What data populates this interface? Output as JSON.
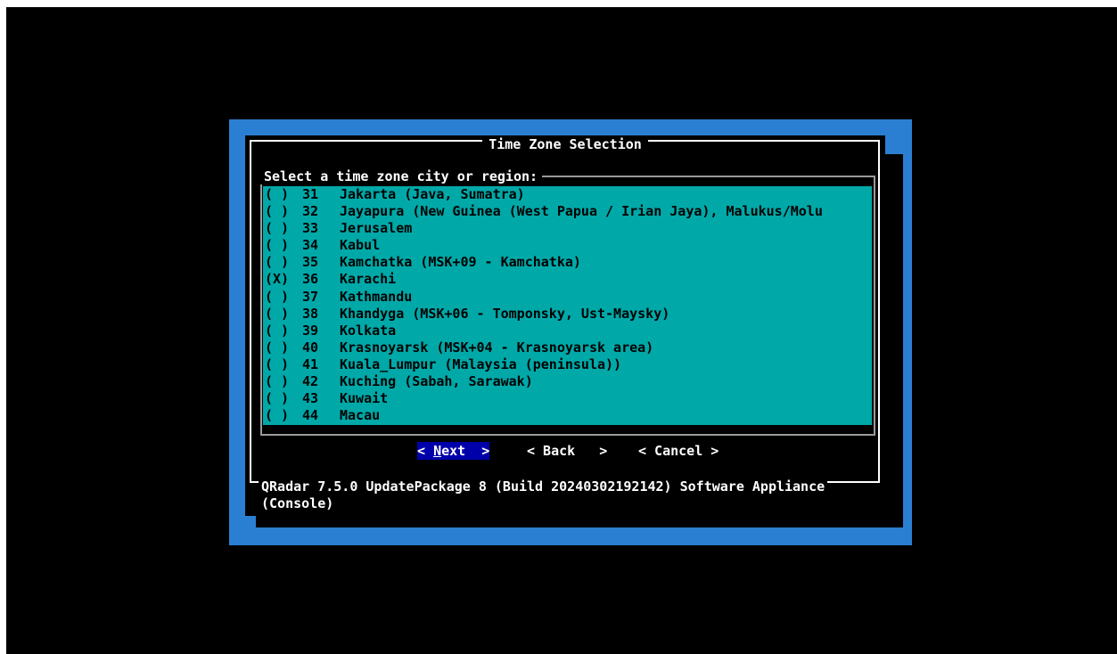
{
  "dialog": {
    "title": "Time Zone Selection",
    "list_label": "Select a time zone city or region:",
    "items": [
      {
        "radio": "( )",
        "num": "31",
        "city": "Jakarta (Java, Sumatra)"
      },
      {
        "radio": "( )",
        "num": "32",
        "city": "Jayapura (New Guinea (West Papua / Irian Jaya), Malukus/Molu"
      },
      {
        "radio": "( )",
        "num": "33",
        "city": "Jerusalem"
      },
      {
        "radio": "( )",
        "num": "34",
        "city": "Kabul"
      },
      {
        "radio": "( )",
        "num": "35",
        "city": "Kamchatka (MSK+09 - Kamchatka)"
      },
      {
        "radio": "(X)",
        "num": "36",
        "city": "Karachi"
      },
      {
        "radio": "( )",
        "num": "37",
        "city": "Kathmandu"
      },
      {
        "radio": "( )",
        "num": "38",
        "city": "Khandyga (MSK+06 - Tomponsky, Ust-Maysky)"
      },
      {
        "radio": "( )",
        "num": "39",
        "city": "Kolkata"
      },
      {
        "radio": "( )",
        "num": "40",
        "city": "Krasnoyarsk (MSK+04 - Krasnoyarsk area)"
      },
      {
        "radio": "( )",
        "num": "41",
        "city": "Kuala_Lumpur (Malaysia (peninsula))"
      },
      {
        "radio": "( )",
        "num": "42",
        "city": "Kuching (Sabah, Sarawak)"
      },
      {
        "radio": "( )",
        "num": "43",
        "city": "Kuwait"
      },
      {
        "radio": "( )",
        "num": "44",
        "city": "Macau"
      }
    ],
    "buttons": {
      "next_left": "< ",
      "next_hotkey": "N",
      "next_rest": "ext",
      "next_right": "  >",
      "back": "< Back   >",
      "cancel": "< Cancel >"
    },
    "footer_line1": "QRadar 7.5.0 UpdatePackage 8 (Build 20240302192142) Software Appliance",
    "footer_line2": "(Console)"
  },
  "colors": {
    "screen": "#000000",
    "desktop": "#2b7fd2",
    "list_bg": "#00a8a8",
    "selected_button": "#0000aa"
  }
}
